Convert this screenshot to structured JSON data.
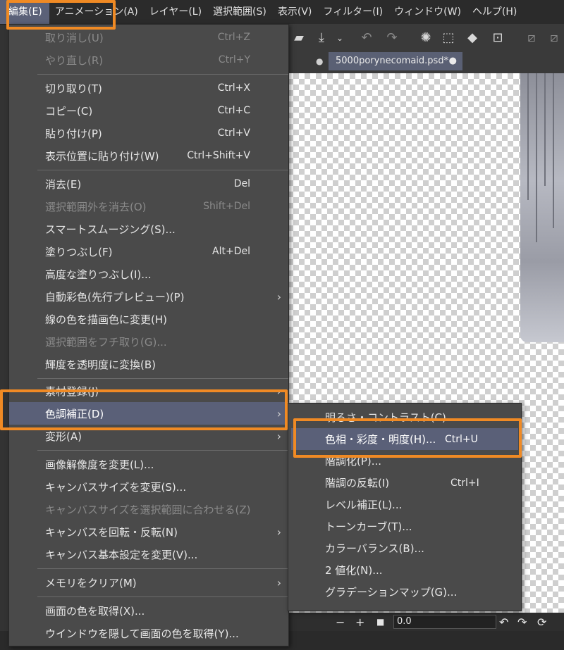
{
  "menubar": {
    "items": [
      {
        "label": "編集(E)",
        "active": true
      },
      {
        "label": "アニメーション(A)"
      },
      {
        "label": "レイヤー(L)"
      },
      {
        "label": "選択範囲(S)"
      },
      {
        "label": "表示(V)"
      },
      {
        "label": "フィルター(I)"
      },
      {
        "label": "ウィンドウ(W)"
      },
      {
        "label": "ヘルプ(H)"
      }
    ]
  },
  "document": {
    "tab_title": "5000porynecomaid.psd*"
  },
  "edit_menu": {
    "items": [
      {
        "label": "取り消し(U)",
        "shortcut": "Ctrl+Z",
        "disabled": true
      },
      {
        "label": "やり直し(R)",
        "shortcut": "Ctrl+Y",
        "disabled": true
      },
      {
        "label": "切り取り(T)",
        "shortcut": "Ctrl+X"
      },
      {
        "label": "コピー(C)",
        "shortcut": "Ctrl+C"
      },
      {
        "label": "貼り付け(P)",
        "shortcut": "Ctrl+V"
      },
      {
        "label": "表示位置に貼り付け(W)",
        "shortcut": "Ctrl+Shift+V"
      },
      {
        "label": "消去(E)",
        "shortcut": "Del"
      },
      {
        "label": "選択範囲外を消去(O)",
        "shortcut": "Shift+Del",
        "disabled": true
      },
      {
        "label": "スマートスムージング(S)..."
      },
      {
        "label": "塗りつぶし(F)",
        "shortcut": "Alt+Del"
      },
      {
        "label": "高度な塗りつぶし(I)..."
      },
      {
        "label": "自動彩色(先行プレビュー)(P)",
        "submenu": true
      },
      {
        "label": "線の色を描画色に変更(H)"
      },
      {
        "label": "選択範囲をフチ取り(G)...",
        "disabled": true
      },
      {
        "label": "輝度を透明度に変換(B)"
      },
      {
        "label": "素材登録(J)",
        "submenu": true
      },
      {
        "label": "色調補正(D)",
        "submenu": true,
        "highlighted": true
      },
      {
        "label": "変形(A)",
        "submenu": true
      },
      {
        "label": "画像解像度を変更(L)..."
      },
      {
        "label": "キャンバスサイズを変更(S)..."
      },
      {
        "label": "キャンバスサイズを選択範囲に合わせる(Z)",
        "disabled": true
      },
      {
        "label": "キャンバスを回転・反転(N)",
        "submenu": true
      },
      {
        "label": "キャンバス基本設定を変更(V)..."
      },
      {
        "label": "メモリをクリア(M)",
        "submenu": true
      },
      {
        "label": "画面の色を取得(X)..."
      },
      {
        "label": "ウインドウを隠して画面の色を取得(Y)..."
      }
    ]
  },
  "color_submenu": {
    "items": [
      {
        "label": "明るさ・コントラスト(C)..."
      },
      {
        "label": "色相・彩度・明度(H)...",
        "shortcut": "Ctrl+U",
        "highlighted": true
      },
      {
        "label": "階調化(P)..."
      },
      {
        "label": "階調の反転(I)",
        "shortcut": "Ctrl+I"
      },
      {
        "label": "レベル補正(L)..."
      },
      {
        "label": "トーンカーブ(T)..."
      },
      {
        "label": "カラーバランス(B)..."
      },
      {
        "label": "2 値化(N)..."
      },
      {
        "label": "グラデーションマップ(G)..."
      }
    ]
  },
  "bottom_toolbar": {
    "zoom_value": "0.0"
  },
  "colors": {
    "highlight": "#5a6078",
    "callout": "#f08a24",
    "menu_bg": "#4a4a4a"
  }
}
